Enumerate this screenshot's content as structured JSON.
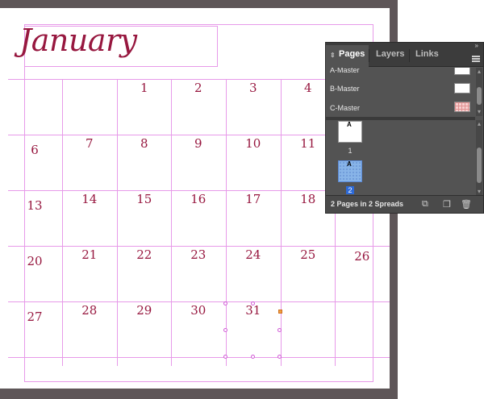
{
  "document": {
    "month_title": "January",
    "days": [
      {
        "label": "1",
        "col": 2,
        "row": 0
      },
      {
        "label": "2",
        "col": 3,
        "row": 0
      },
      {
        "label": "3",
        "col": 4,
        "row": 0
      },
      {
        "label": "4",
        "col": 5,
        "row": 0
      },
      {
        "label": "6",
        "col": 0,
        "row": 1
      },
      {
        "label": "7",
        "col": 1,
        "row": 1
      },
      {
        "label": "8",
        "col": 2,
        "row": 1
      },
      {
        "label": "9",
        "col": 3,
        "row": 1
      },
      {
        "label": "10",
        "col": 4,
        "row": 1
      },
      {
        "label": "11",
        "col": 5,
        "row": 1
      },
      {
        "label": "13",
        "col": 0,
        "row": 2
      },
      {
        "label": "14",
        "col": 1,
        "row": 2
      },
      {
        "label": "15",
        "col": 2,
        "row": 2
      },
      {
        "label": "16",
        "col": 3,
        "row": 2
      },
      {
        "label": "17",
        "col": 4,
        "row": 2
      },
      {
        "label": "18",
        "col": 5,
        "row": 2
      },
      {
        "label": "20",
        "col": 0,
        "row": 3
      },
      {
        "label": "21",
        "col": 1,
        "row": 3
      },
      {
        "label": "22",
        "col": 2,
        "row": 3
      },
      {
        "label": "23",
        "col": 3,
        "row": 3
      },
      {
        "label": "24",
        "col": 4,
        "row": 3
      },
      {
        "label": "25",
        "col": 5,
        "row": 3
      },
      {
        "label": "26",
        "col": 6,
        "row": 3
      },
      {
        "label": "27",
        "col": 0,
        "row": 4
      },
      {
        "label": "28",
        "col": 1,
        "row": 4
      },
      {
        "label": "29",
        "col": 2,
        "row": 4
      },
      {
        "label": "30",
        "col": 3,
        "row": 4
      },
      {
        "label": "31",
        "col": 4,
        "row": 4
      }
    ]
  },
  "panel": {
    "tabs": [
      {
        "label": "Pages",
        "active": true
      },
      {
        "label": "Layers",
        "active": false
      },
      {
        "label": "Links",
        "active": false
      }
    ],
    "masters": [
      {
        "label": "A-Master",
        "thumb": "blank"
      },
      {
        "label": "B-Master",
        "thumb": "blank"
      },
      {
        "label": "C-Master",
        "thumb": "grid"
      }
    ],
    "pages": [
      {
        "number": "1",
        "master_prefix": "A",
        "selected": false
      },
      {
        "number": "2",
        "master_prefix": "A",
        "selected": true
      }
    ],
    "footer_text": "2 Pages in 2 Spreads",
    "icons": {
      "tab_toggle": "up-down-arrows-icon",
      "menu": "panel-menu-icon",
      "edit_page_size": "page-size-icon",
      "new_page": "new-page-icon",
      "delete": "trash-icon"
    },
    "colors": {
      "panel_bg": "#535353",
      "selected_page": "#88b4e8",
      "selection_blue": "#2d6ad8"
    }
  },
  "colors": {
    "accent": "#97173f",
    "guide": "#e79ae9"
  }
}
